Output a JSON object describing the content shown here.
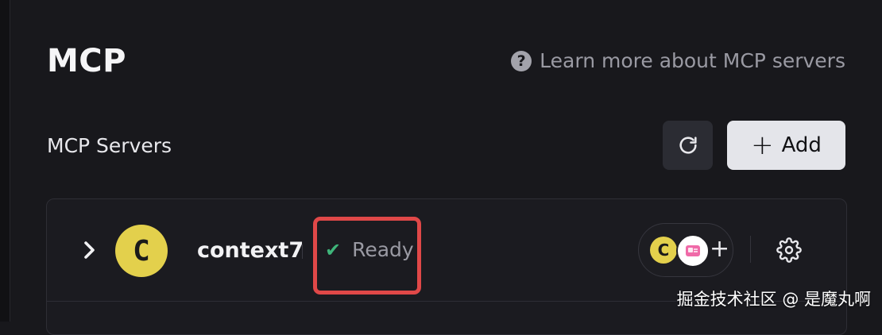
{
  "page": {
    "title": "MCP",
    "learn_more": "Learn more about MCP servers",
    "help_glyph": "?"
  },
  "section": {
    "title": "MCP Servers"
  },
  "toolbar": {
    "refresh_icon": "refresh-icon",
    "add_glyph": "+",
    "add_label": "Add"
  },
  "servers": [
    {
      "avatar_letter": "C",
      "name": "context7",
      "status_glyph": "✔",
      "status": "Ready",
      "clients": {
        "first_letter": "C",
        "add_glyph": "+"
      }
    }
  ],
  "colors": {
    "background": "#18181c",
    "avatar": "#e3d04c",
    "status_ok": "#3fb57a",
    "highlight": "#e04848",
    "add_button_bg": "#e4e5ea"
  },
  "watermark": "掘金技术社区 @ 是魔丸啊"
}
